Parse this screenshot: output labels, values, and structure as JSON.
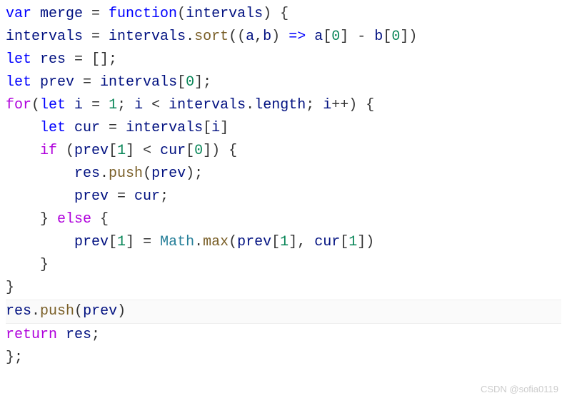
{
  "code": {
    "lines": [
      {
        "tokens": [
          {
            "t": "var ",
            "c": "kw-var"
          },
          {
            "t": "merge",
            "c": "identifier"
          },
          {
            "t": " = ",
            "c": "punct"
          },
          {
            "t": "function",
            "c": "kw-function"
          },
          {
            "t": "(",
            "c": "punct"
          },
          {
            "t": "intervals",
            "c": "param"
          },
          {
            "t": ") {",
            "c": "punct"
          }
        ]
      },
      {
        "tokens": [
          {
            "t": "intervals",
            "c": "identifier"
          },
          {
            "t": " = ",
            "c": "punct"
          },
          {
            "t": "intervals",
            "c": "identifier"
          },
          {
            "t": ".",
            "c": "punct"
          },
          {
            "t": "sort",
            "c": "method"
          },
          {
            "t": "((",
            "c": "punct"
          },
          {
            "t": "a",
            "c": "param"
          },
          {
            "t": ",",
            "c": "punct"
          },
          {
            "t": "b",
            "c": "param"
          },
          {
            "t": ") ",
            "c": "punct"
          },
          {
            "t": "=>",
            "c": "kw-var"
          },
          {
            "t": " ",
            "c": "punct"
          },
          {
            "t": "a",
            "c": "identifier"
          },
          {
            "t": "[",
            "c": "punct"
          },
          {
            "t": "0",
            "c": "number"
          },
          {
            "t": "] - ",
            "c": "punct"
          },
          {
            "t": "b",
            "c": "identifier"
          },
          {
            "t": "[",
            "c": "punct"
          },
          {
            "t": "0",
            "c": "number"
          },
          {
            "t": "])",
            "c": "punct"
          }
        ]
      },
      {
        "tokens": [
          {
            "t": "let ",
            "c": "kw-let"
          },
          {
            "t": "res",
            "c": "identifier"
          },
          {
            "t": " = [];",
            "c": "punct"
          }
        ]
      },
      {
        "tokens": [
          {
            "t": "let ",
            "c": "kw-let"
          },
          {
            "t": "prev",
            "c": "identifier"
          },
          {
            "t": " = ",
            "c": "punct"
          },
          {
            "t": "intervals",
            "c": "identifier"
          },
          {
            "t": "[",
            "c": "punct"
          },
          {
            "t": "0",
            "c": "number"
          },
          {
            "t": "];",
            "c": "punct"
          }
        ]
      },
      {
        "tokens": [
          {
            "t": "for",
            "c": "kw-for"
          },
          {
            "t": "(",
            "c": "punct"
          },
          {
            "t": "let ",
            "c": "kw-let"
          },
          {
            "t": "i",
            "c": "identifier"
          },
          {
            "t": " = ",
            "c": "punct"
          },
          {
            "t": "1",
            "c": "number"
          },
          {
            "t": "; ",
            "c": "punct"
          },
          {
            "t": "i",
            "c": "identifier"
          },
          {
            "t": " < ",
            "c": "punct"
          },
          {
            "t": "intervals",
            "c": "identifier"
          },
          {
            "t": ".",
            "c": "punct"
          },
          {
            "t": "length",
            "c": "prop"
          },
          {
            "t": "; ",
            "c": "punct"
          },
          {
            "t": "i",
            "c": "identifier"
          },
          {
            "t": "++) {",
            "c": "punct"
          }
        ]
      },
      {
        "indent": 1,
        "tokens": [
          {
            "t": "    ",
            "c": "punct"
          },
          {
            "t": "let ",
            "c": "kw-let"
          },
          {
            "t": "cur",
            "c": "identifier"
          },
          {
            "t": " = ",
            "c": "punct"
          },
          {
            "t": "intervals",
            "c": "identifier"
          },
          {
            "t": "[",
            "c": "punct"
          },
          {
            "t": "i",
            "c": "identifier"
          },
          {
            "t": "]",
            "c": "punct"
          }
        ]
      },
      {
        "indent": 1,
        "tokens": [
          {
            "t": "    ",
            "c": "punct"
          },
          {
            "t": "if",
            "c": "kw-if"
          },
          {
            "t": " (",
            "c": "punct"
          },
          {
            "t": "prev",
            "c": "identifier"
          },
          {
            "t": "[",
            "c": "punct"
          },
          {
            "t": "1",
            "c": "number"
          },
          {
            "t": "] < ",
            "c": "punct"
          },
          {
            "t": "cur",
            "c": "identifier"
          },
          {
            "t": "[",
            "c": "punct"
          },
          {
            "t": "0",
            "c": "number"
          },
          {
            "t": "]) {",
            "c": "punct"
          }
        ]
      },
      {
        "indent": 2,
        "tokens": [
          {
            "t": "        ",
            "c": "punct"
          },
          {
            "t": "res",
            "c": "identifier"
          },
          {
            "t": ".",
            "c": "punct"
          },
          {
            "t": "push",
            "c": "method"
          },
          {
            "t": "(",
            "c": "punct"
          },
          {
            "t": "prev",
            "c": "identifier"
          },
          {
            "t": ");",
            "c": "punct"
          }
        ]
      },
      {
        "indent": 2,
        "tokens": [
          {
            "t": "        ",
            "c": "punct"
          },
          {
            "t": "prev",
            "c": "identifier"
          },
          {
            "t": " = ",
            "c": "punct"
          },
          {
            "t": "cur",
            "c": "identifier"
          },
          {
            "t": ";",
            "c": "punct"
          }
        ]
      },
      {
        "indent": 1,
        "tokens": [
          {
            "t": "    } ",
            "c": "punct"
          },
          {
            "t": "else",
            "c": "kw-else"
          },
          {
            "t": " {",
            "c": "punct"
          }
        ]
      },
      {
        "indent": 2,
        "tokens": [
          {
            "t": "        ",
            "c": "punct"
          },
          {
            "t": "prev",
            "c": "identifier"
          },
          {
            "t": "[",
            "c": "punct"
          },
          {
            "t": "1",
            "c": "number"
          },
          {
            "t": "] = ",
            "c": "punct"
          },
          {
            "t": "Math",
            "c": "type"
          },
          {
            "t": ".",
            "c": "punct"
          },
          {
            "t": "max",
            "c": "method"
          },
          {
            "t": "(",
            "c": "punct"
          },
          {
            "t": "prev",
            "c": "identifier"
          },
          {
            "t": "[",
            "c": "punct"
          },
          {
            "t": "1",
            "c": "number"
          },
          {
            "t": "], ",
            "c": "punct"
          },
          {
            "t": "cur",
            "c": "identifier"
          },
          {
            "t": "[",
            "c": "punct"
          },
          {
            "t": "1",
            "c": "number"
          },
          {
            "t": "])",
            "c": "punct"
          }
        ]
      },
      {
        "indent": 1,
        "tokens": [
          {
            "t": "    }",
            "c": "punct"
          }
        ]
      },
      {
        "tokens": [
          {
            "t": "}",
            "c": "punct"
          }
        ]
      },
      {
        "highlighted": true,
        "tokens": [
          {
            "t": "res",
            "c": "identifier"
          },
          {
            "t": ".",
            "c": "punct"
          },
          {
            "t": "push",
            "c": "method"
          },
          {
            "t": "(",
            "c": "punct"
          },
          {
            "t": "prev",
            "c": "identifier"
          },
          {
            "t": ")",
            "c": "punct"
          }
        ]
      },
      {
        "tokens": [
          {
            "t": "return ",
            "c": "kw-return"
          },
          {
            "t": "res",
            "c": "identifier"
          },
          {
            "t": ";",
            "c": "punct"
          }
        ]
      },
      {
        "tokens": [
          {
            "t": "};",
            "c": "punct"
          }
        ]
      }
    ]
  },
  "watermark": "CSDN @sofia0119"
}
